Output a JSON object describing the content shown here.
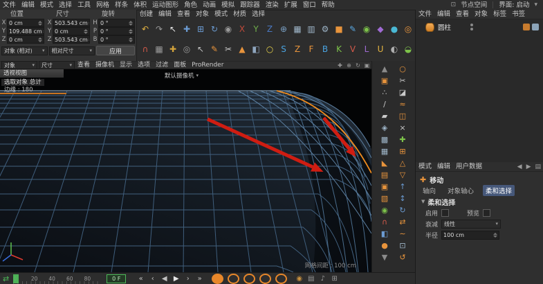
{
  "colors": {
    "accent_orange": "#e8872a",
    "selection_blue": "#46587a",
    "wire_blue": "#45607d",
    "arrow_red": "#cf1d12",
    "playhead_green": "#4cba58"
  },
  "menubar": {
    "items": [
      "文件",
      "编辑",
      "模式",
      "选择",
      "工具",
      "网格",
      "样条",
      "体积",
      "运动图形",
      "角色",
      "动画",
      "模拟",
      "跟踪器",
      "渲染",
      "扩展",
      "窗口",
      "帮助"
    ],
    "node_space": "节点空间",
    "layout": "界面: 启动"
  },
  "palette_menus": [
    "创建",
    "编辑",
    "查看",
    "对象",
    "模式",
    "材质",
    "选择"
  ],
  "toolbar": {
    "row1": [
      {
        "name": "undo-icon",
        "glyph": "↶",
        "color": "#e3b341"
      },
      {
        "name": "redo-icon",
        "glyph": "↷",
        "color": "#9a9a9a"
      },
      {
        "name": "live-selection-icon",
        "glyph": "↖",
        "color": "#e6e6e6"
      },
      {
        "name": "move-tool-icon",
        "glyph": "✚",
        "color": "#6b9bd2"
      },
      {
        "name": "scale-tool-icon",
        "glyph": "⊞",
        "color": "#6b9bd2"
      },
      {
        "name": "rotate-tool-icon",
        "glyph": "↻",
        "color": "#6b9bd2"
      },
      {
        "name": "last-tool-icon",
        "glyph": "◉",
        "color": "#9a9a9a"
      },
      {
        "name": "axis-x-icon",
        "glyph": "X",
        "color": "#c04a3a"
      },
      {
        "name": "axis-y-icon",
        "glyph": "Y",
        "color": "#6fae4a"
      },
      {
        "name": "axis-z-icon",
        "glyph": "Z",
        "color": "#4a77c0"
      },
      {
        "name": "coord-system-icon",
        "glyph": "⊕",
        "color": "#7aa0c4"
      },
      {
        "name": "render-view-icon",
        "glyph": "▦",
        "color": "#9fb6c9"
      },
      {
        "name": "render-picture-icon",
        "glyph": "▥",
        "color": "#9fb6c9"
      },
      {
        "name": "render-settings-icon",
        "glyph": "⚙",
        "color": "#9fb6c9"
      },
      {
        "name": "cube-primitive-icon",
        "glyph": "■",
        "color": "#e8943c"
      },
      {
        "name": "pen-spline-icon",
        "glyph": "✎",
        "color": "#5aa7e0"
      },
      {
        "name": "subdivision-surface-icon",
        "glyph": "◉",
        "color": "#7dc24a"
      },
      {
        "name": "bend-deformer-icon",
        "glyph": "◆",
        "color": "#a06bd4"
      },
      {
        "name": "volume-builder-icon",
        "glyph": "●",
        "color": "#4ab8d4"
      },
      {
        "name": "field-icon",
        "glyph": "◎",
        "color": "#e8943c"
      }
    ],
    "row2": [
      {
        "name": "snap-icon",
        "glyph": "∩",
        "color": "#d45a4a"
      },
      {
        "name": "workplane-icon",
        "glyph": "▦",
        "color": "#9a9a9a"
      },
      {
        "name": "axis-edit-icon",
        "glyph": "✚",
        "color": "#d4a43c"
      },
      {
        "name": "solo-icon",
        "glyph": "◎",
        "color": "#9a9a9a"
      },
      {
        "name": "tweak-icon",
        "glyph": "↖",
        "color": "#c0c0c0"
      },
      {
        "name": "polygon-pen-icon",
        "glyph": "✎",
        "color": "#e8943c"
      },
      {
        "name": "knife-icon",
        "glyph": "✂",
        "color": "#c9c9c9"
      },
      {
        "name": "extrude-icon",
        "glyph": "▲",
        "color": "#e8943c"
      },
      {
        "name": "camera-icon",
        "glyph": "◧",
        "color": "#8fa6bf"
      },
      {
        "name": "light-icon",
        "glyph": "○",
        "color": "#e6d14a"
      },
      {
        "name": "letter-s-icon",
        "glyph": "S",
        "color": "#4aa3e0"
      },
      {
        "name": "letter-z-icon",
        "glyph": "Z",
        "color": "#e8943c"
      },
      {
        "name": "letter-f-icon",
        "glyph": "F",
        "color": "#e8943c"
      },
      {
        "name": "letter-b-icon",
        "glyph": "B",
        "color": "#4aa3e0"
      },
      {
        "name": "letter-k-icon",
        "glyph": "K",
        "color": "#7dc24a"
      },
      {
        "name": "letter-v-icon",
        "glyph": "V",
        "color": "#d45a4a"
      },
      {
        "name": "letter-l-icon",
        "glyph": "L",
        "color": "#a06bd4"
      },
      {
        "name": "letter-u-icon",
        "glyph": "U",
        "color": "#e3b341"
      },
      {
        "name": "material-icon",
        "glyph": "◐",
        "color": "#b0b0b0"
      },
      {
        "name": "environment-icon",
        "glyph": "◒",
        "color": "#7dc24a"
      }
    ]
  },
  "coord_panel": {
    "headers": [
      "位置",
      "尺寸",
      "旋转"
    ],
    "rows": [
      {
        "a": "X",
        "pos": "0 cm",
        "b": "X",
        "size": "503.543 cm",
        "c": "H",
        "rot": "0 °"
      },
      {
        "a": "Y",
        "pos": "109.488 cm",
        "b": "Y",
        "size": "0 cm",
        "c": "P",
        "rot": "0 °"
      },
      {
        "a": "Z",
        "pos": "0 cm",
        "b": "Z",
        "size": "503.543 cm",
        "c": "B",
        "rot": "0 °"
      }
    ],
    "mode_dropdown": "对象 (相对)",
    "size_dropdown": "相对尺寸",
    "apply": "应用",
    "sub_dropdown_1": "对象",
    "sub_dropdown_2": "尺寸"
  },
  "viewport": {
    "menus": [
      "查看",
      "摄像机",
      "显示",
      "选项",
      "过滤",
      "面板",
      "ProRender"
    ],
    "view_tab": "透视视图",
    "camera_label": "默认摄像机",
    "hud_selection": "选取对象 总计",
    "hud_edges": "边缘 : 180",
    "grid_hint": "网格间距 : 100 cm",
    "nav_icons": [
      {
        "name": "view-pan-icon",
        "glyph": "✚",
        "color": "#9a9a9a"
      },
      {
        "name": "view-zoom-icon",
        "glyph": "⊕",
        "color": "#9a9a9a"
      },
      {
        "name": "view-rotate-icon",
        "glyph": "↻",
        "color": "#9a9a9a"
      },
      {
        "name": "view-toggle-icon",
        "glyph": "▣",
        "color": "#9a9a9a"
      }
    ]
  },
  "right_palette": {
    "col1": [
      {
        "name": "scroll-up-icon",
        "glyph": "▲",
        "color": "#8a8a8a"
      },
      {
        "name": "make-editable-icon",
        "glyph": "▣",
        "color": "#e8943c"
      },
      {
        "name": "points-mode-icon",
        "glyph": "∴",
        "color": "#c9c9c9"
      },
      {
        "name": "edges-mode-icon",
        "glyph": "∕",
        "color": "#c9c9c9"
      },
      {
        "name": "polygons-mode-icon",
        "glyph": "▰",
        "color": "#c9c9c9"
      },
      {
        "name": "model-mode-icon",
        "glyph": "◈",
        "color": "#9fb6c9"
      },
      {
        "name": "texture-mode-icon",
        "glyph": "▩",
        "color": "#9fb6c9"
      },
      {
        "name": "workplane-mode-icon",
        "glyph": "▦",
        "color": "#9fb6c9"
      },
      {
        "name": "bevel-tool-icon",
        "glyph": "◣",
        "color": "#e8943c"
      },
      {
        "name": "extrude-tool-icon",
        "glyph": "▤",
        "color": "#e8943c"
      },
      {
        "name": "inner-extrude-icon",
        "glyph": "▣",
        "color": "#e8943c"
      },
      {
        "name": "matrix-extrude-icon",
        "glyph": "▧",
        "color": "#e8943c"
      },
      {
        "name": "smoothing-icon",
        "glyph": "◉",
        "color": "#7dc24a"
      },
      {
        "name": "magnet-tool-icon",
        "glyph": "∩",
        "color": "#d45a4a"
      },
      {
        "name": "mirror-tool-icon",
        "glyph": "◧",
        "color": "#6b9bd2"
      },
      {
        "name": "weld-tool-icon",
        "glyph": "●",
        "color": "#e8943c"
      },
      {
        "name": "scroll-down-icon",
        "glyph": "▼",
        "color": "#8a8a8a"
      }
    ],
    "col2": [
      {
        "name": "close-hole-icon",
        "glyph": "○",
        "color": "#e8943c"
      },
      {
        "name": "line-cut-icon",
        "glyph": "✂",
        "color": "#c9c9c9"
      },
      {
        "name": "plane-cut-icon",
        "glyph": "◪",
        "color": "#c9c9c9"
      },
      {
        "name": "loop-cut-icon",
        "glyph": "≈",
        "color": "#e8943c"
      },
      {
        "name": "split-icon",
        "glyph": "◫",
        "color": "#e8943c"
      },
      {
        "name": "dissolve-icon",
        "glyph": "×",
        "color": "#c9c9c9"
      },
      {
        "name": "optimize-icon",
        "glyph": "✚",
        "color": "#7dc24a"
      },
      {
        "name": "subdivide-icon",
        "glyph": "⊞",
        "color": "#e8943c"
      },
      {
        "name": "triangulate-icon",
        "glyph": "△",
        "color": "#e8943c"
      },
      {
        "name": "untriangulate-icon",
        "glyph": "▽",
        "color": "#e8943c"
      },
      {
        "name": "normal-move-icon",
        "glyph": "↑",
        "color": "#6b9bd2"
      },
      {
        "name": "normal-scale-icon",
        "glyph": "↕",
        "color": "#6b9bd2"
      },
      {
        "name": "normal-rotate-icon",
        "glyph": "↻",
        "color": "#6b9bd2"
      },
      {
        "name": "slide-icon",
        "glyph": "⇄",
        "color": "#e8943c"
      },
      {
        "name": "stitch-sew-icon",
        "glyph": "∼",
        "color": "#e8943c"
      },
      {
        "name": "array-icon",
        "glyph": "⊡",
        "color": "#9fb6c9"
      },
      {
        "name": "spin-edge-icon",
        "glyph": "↺",
        "color": "#e8943c"
      }
    ]
  },
  "object_manager": {
    "menus": [
      "文件",
      "编辑",
      "查看",
      "对象",
      "标签",
      "书签"
    ],
    "objects": [
      {
        "name": "圆柱"
      }
    ]
  },
  "attribute_manager": {
    "menus": [
      "模式",
      "编辑",
      "用户数据"
    ],
    "tool_name": "移动",
    "tabs": [
      "轴向",
      "对象轴心",
      "柔和选择"
    ],
    "section_title": "柔和选择",
    "enable_label": "启用",
    "preview_label": "预览",
    "falloff_label": "衰减",
    "falloff_value": "线性",
    "radius_label": "半径",
    "radius_value": "100 cm"
  },
  "timeline": {
    "labels": [
      "0",
      "20",
      "40",
      "60",
      "80"
    ],
    "current_frame": "0 F",
    "transport": [
      {
        "name": "go-start-icon",
        "glyph": "«",
        "color": "#c0c0c0"
      },
      {
        "name": "prev-key-icon",
        "glyph": "‹",
        "color": "#c0c0c0"
      },
      {
        "name": "prev-frame-icon",
        "glyph": "◀",
        "color": "#c0c0c0"
      },
      {
        "name": "play-icon",
        "glyph": "▶",
        "color": "#e6e6e6"
      },
      {
        "name": "next-frame-icon",
        "glyph": "›",
        "color": "#c0c0c0"
      },
      {
        "name": "go-end-icon",
        "glyph": "»",
        "color": "#c0c0c0"
      }
    ],
    "record": [
      {
        "name": "record-keyframe-icon",
        "cls": "rec rec-filled"
      },
      {
        "name": "key-position-icon",
        "cls": "rec"
      },
      {
        "name": "key-scale-icon",
        "cls": "rec"
      },
      {
        "name": "key-rotation-icon",
        "cls": "rec"
      },
      {
        "name": "key-parameter-icon",
        "cls": "rec"
      }
    ],
    "extra": [
      {
        "name": "autokey-icon",
        "glyph": "◉",
        "color": "#c9913f"
      },
      {
        "name": "timeline-options-icon",
        "glyph": "▤",
        "color": "#9a9a9a"
      },
      {
        "name": "sound-icon",
        "glyph": "♪",
        "color": "#9a9a9a"
      },
      {
        "name": "magnify-icon",
        "glyph": "⊞",
        "color": "#9a9a9a"
      }
    ]
  }
}
